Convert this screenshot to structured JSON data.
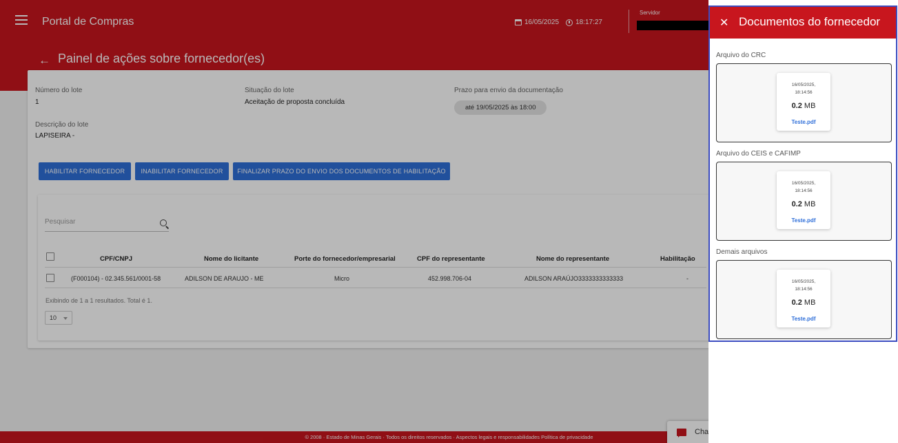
{
  "header": {
    "app_title": "Portal de Compras",
    "date": "16/05/2025",
    "time": "18:17:27",
    "server_label": "Servidor",
    "page_title": "Painel de ações sobre fornecedor(es)"
  },
  "lote": {
    "numero_label": "Número do lote",
    "numero_value": "1",
    "situacao_label": "Situação do lote",
    "situacao_value": "Aceitação de proposta concluída",
    "prazo_label": "Prazo para envio da documentação",
    "prazo_value": "até 19/05/2025 às 18:00",
    "descricao_label": "Descrição do lote",
    "descricao_value": "LAPISEIRA -"
  },
  "actions": {
    "habilitar": "HABILITAR FORNECEDOR",
    "inabilitar": "INABILITAR FORNECEDOR",
    "finalizar": "FINALIZAR PRAZO DO ENVIO DOS DOCUMENTOS DE HABILITAÇÃO"
  },
  "search": {
    "placeholder": "Pesquisar"
  },
  "table": {
    "headers": {
      "cpf_cnpj": "CPF/CNPJ",
      "nome_licitante": "Nome do licitante",
      "porte": "Porte do fornecedor/empresarial",
      "cpf_representante": "CPF do representante",
      "nome_representante": "Nome do representante",
      "habilitacao": "Habilitação"
    },
    "rows": [
      {
        "cpf_cnpj": "(F000104) - 02.345.561/0001-58",
        "nome_licitante": "ADILSON DE ARAUJO - ME",
        "porte": "Micro",
        "cpf_representante": "452.998.706-04",
        "nome_representante": "ADILSON ARAÚJO3333333333333",
        "habilitacao": "-"
      }
    ],
    "results_text": "Exibindo de 1 a 1 resultados. Total é 1.",
    "page_size": "10"
  },
  "footer": {
    "text": "© 2008 · Estado de Minas Gerais · Todos os direitos reservados · Aspectos legais e responsabilidades  Política de privacidade",
    "chat_label": "Cha"
  },
  "panel": {
    "title": "Documentos do fornecedor",
    "sections": [
      {
        "label": "Arquivo do CRC",
        "date_line1": "16/05/2025,",
        "date_line2": "18:14:56",
        "size_value": "0.2",
        "size_unit": "MB",
        "filename": "Teste.pdf"
      },
      {
        "label": "Arquivo do CEIS e CAFIMP",
        "date_line1": "16/05/2025,",
        "date_line2": "18:14:56",
        "size_value": "0.2",
        "size_unit": "MB",
        "filename": "Teste.pdf"
      },
      {
        "label": "Demais arquivos",
        "date_line1": "16/05/2025,",
        "date_line2": "18:14:56",
        "size_value": "0.2",
        "size_unit": "MB",
        "filename": "Teste.pdf"
      }
    ]
  },
  "colors": {
    "brand_red": "#c8161e",
    "button_blue": "#2f6fd9",
    "panel_outline": "#3b4cc0"
  }
}
